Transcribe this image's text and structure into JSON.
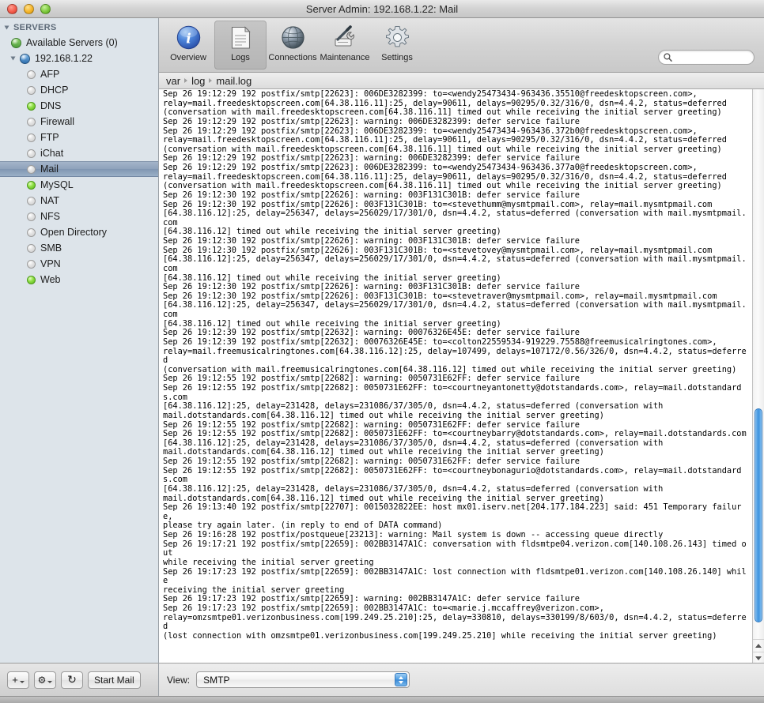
{
  "window": {
    "title": "Server Admin: 192.168.1.22: Mail"
  },
  "sidebar": {
    "group_label": "SERVERS",
    "available_servers": "Available Servers (0)",
    "host": "192.168.1.22",
    "services": [
      {
        "label": "AFP",
        "running": false
      },
      {
        "label": "DHCP",
        "running": false
      },
      {
        "label": "DNS",
        "running": true
      },
      {
        "label": "Firewall",
        "running": false
      },
      {
        "label": "FTP",
        "running": false
      },
      {
        "label": "iChat",
        "running": false
      },
      {
        "label": "Mail",
        "running": false,
        "selected": true
      },
      {
        "label": "MySQL",
        "running": true
      },
      {
        "label": "NAT",
        "running": false
      },
      {
        "label": "NFS",
        "running": false
      },
      {
        "label": "Open Directory",
        "running": false
      },
      {
        "label": "SMB",
        "running": false
      },
      {
        "label": "VPN",
        "running": false
      },
      {
        "label": "Web",
        "running": true
      }
    ],
    "buttons": {
      "add_label": "+",
      "action_label": "⚙",
      "refresh_label": "↻",
      "start_service_label": "Start Mail"
    }
  },
  "toolbar": {
    "items": [
      {
        "label": "Overview",
        "icon": "info-icon",
        "active": false
      },
      {
        "label": "Logs",
        "icon": "document-icon",
        "active": true
      },
      {
        "label": "Connections",
        "icon": "globe-icon",
        "active": false
      },
      {
        "label": "Maintenance",
        "icon": "tools-icon",
        "active": false
      },
      {
        "label": "Settings",
        "icon": "gear-icon",
        "active": false
      }
    ],
    "search": {
      "value": "",
      "placeholder": ""
    }
  },
  "breadcrumb": {
    "parts": [
      "var",
      "log",
      "mail.log"
    ]
  },
  "log": {
    "content": "Sep 26 19:12:29 192 postfix/smtp[22623]: 006DE3282399: to=<wendy25473434-963436.35510@freedesktopscreen.com>,\nrelay=mail.freedesktopscreen.com[64.38.116.11]:25, delay=90611, delays=90295/0.32/316/0, dsn=4.4.2, status=deferred\n(conversation with mail.freedesktopscreen.com[64.38.116.11] timed out while receiving the initial server greeting)\nSep 26 19:12:29 192 postfix/smtp[22623]: warning: 006DE3282399: defer service failure\nSep 26 19:12:29 192 postfix/smtp[22623]: 006DE3282399: to=<wendy25473434-963436.372b0@freedesktopscreen.com>,\nrelay=mail.freedesktopscreen.com[64.38.116.11]:25, delay=90611, delays=90295/0.32/316/0, dsn=4.4.2, status=deferred\n(conversation with mail.freedesktopscreen.com[64.38.116.11] timed out while receiving the initial server greeting)\nSep 26 19:12:29 192 postfix/smtp[22623]: warning: 006DE3282399: defer service failure\nSep 26 19:12:29 192 postfix/smtp[22623]: 006DE3282399: to=<wendy25473434-963436.377a0@freedesktopscreen.com>,\nrelay=mail.freedesktopscreen.com[64.38.116.11]:25, delay=90611, delays=90295/0.32/316/0, dsn=4.4.2, status=deferred\n(conversation with mail.freedesktopscreen.com[64.38.116.11] timed out while receiving the initial server greeting)\nSep 26 19:12:30 192 postfix/smtp[22626]: warning: 003F131C301B: defer service failure\nSep 26 19:12:30 192 postfix/smtp[22626]: 003F131C301B: to=<stevethumm@mysmtpmail.com>, relay=mail.mysmtpmail.com\n[64.38.116.12]:25, delay=256347, delays=256029/17/301/0, dsn=4.4.2, status=deferred (conversation with mail.mysmtpmail.com\n[64.38.116.12] timed out while receiving the initial server greeting)\nSep 26 19:12:30 192 postfix/smtp[22626]: warning: 003F131C301B: defer service failure\nSep 26 19:12:30 192 postfix/smtp[22626]: 003F131C301B: to=<stevetovey@mysmtpmail.com>, relay=mail.mysmtpmail.com\n[64.38.116.12]:25, delay=256347, delays=256029/17/301/0, dsn=4.4.2, status=deferred (conversation with mail.mysmtpmail.com\n[64.38.116.12] timed out while receiving the initial server greeting)\nSep 26 19:12:30 192 postfix/smtp[22626]: warning: 003F131C301B: defer service failure\nSep 26 19:12:30 192 postfix/smtp[22626]: 003F131C301B: to=<stevetraver@mysmtpmail.com>, relay=mail.mysmtpmail.com\n[64.38.116.12]:25, delay=256347, delays=256029/17/301/0, dsn=4.4.2, status=deferred (conversation with mail.mysmtpmail.com\n[64.38.116.12] timed out while receiving the initial server greeting)\nSep 26 19:12:39 192 postfix/smtp[22632]: warning: 00076326E45E: defer service failure\nSep 26 19:12:39 192 postfix/smtp[22632]: 00076326E45E: to=<colton22559534-919229.75588@freemusicalringtones.com>,\nrelay=mail.freemusicalringtones.com[64.38.116.12]:25, delay=107499, delays=107172/0.56/326/0, dsn=4.4.2, status=deferred\n(conversation with mail.freemusicalringtones.com[64.38.116.12] timed out while receiving the initial server greeting)\nSep 26 19:12:55 192 postfix/smtp[22682]: warning: 0050731E62FF: defer service failure\nSep 26 19:12:55 192 postfix/smtp[22682]: 0050731E62FF: to=<courtneyantonetty@dotstandards.com>, relay=mail.dotstandards.com\n[64.38.116.12]:25, delay=231428, delays=231086/37/305/0, dsn=4.4.2, status=deferred (conversation with\nmail.dotstandards.com[64.38.116.12] timed out while receiving the initial server greeting)\nSep 26 19:12:55 192 postfix/smtp[22682]: warning: 0050731E62FF: defer service failure\nSep 26 19:12:55 192 postfix/smtp[22682]: 0050731E62FF: to=<courtneybarry@dotstandards.com>, relay=mail.dotstandards.com\n[64.38.116.12]:25, delay=231428, delays=231086/37/305/0, dsn=4.4.2, status=deferred (conversation with\nmail.dotstandards.com[64.38.116.12] timed out while receiving the initial server greeting)\nSep 26 19:12:55 192 postfix/smtp[22682]: warning: 0050731E62FF: defer service failure\nSep 26 19:12:55 192 postfix/smtp[22682]: 0050731E62FF: to=<courtneybonagurio@dotstandards.com>, relay=mail.dotstandards.com\n[64.38.116.12]:25, delay=231428, delays=231086/37/305/0, dsn=4.4.2, status=deferred (conversation with\nmail.dotstandards.com[64.38.116.12] timed out while receiving the initial server greeting)\nSep 26 19:13:40 192 postfix/smtp[22707]: 0015032822EE: host mx01.iserv.net[204.177.184.223] said: 451 Temporary failure,\nplease try again later. (in reply to end of DATA command)\nSep 26 19:16:28 192 postfix/postqueue[23213]: warning: Mail system is down -- accessing queue directly\nSep 26 19:17:21 192 postfix/smtp[22659]: 002BB3147A1C: conversation with fldsmtpe04.verizon.com[140.108.26.143] timed out\nwhile receiving the initial server greeting\nSep 26 19:17:23 192 postfix/smtp[22659]: 002BB3147A1C: lost connection with fldsmtpe01.verizon.com[140.108.26.140] while\nreceiving the initial server greeting\nSep 26 19:17:23 192 postfix/smtp[22659]: warning: 002BB3147A1C: defer service failure\nSep 26 19:17:23 192 postfix/smtp[22659]: 002BB3147A1C: to=<marie.j.mccaffrey@verizon.com>,\nrelay=omzsmtpe01.verizonbusiness.com[199.249.25.210]:25, delay=330810, delays=330199/8/603/0, dsn=4.4.2, status=deferred\n(lost connection with omzsmtpe01.verizonbusiness.com[199.249.25.210] while receiving the initial server greeting)"
  },
  "viewbar": {
    "label": "View:",
    "selected": "SMTP"
  },
  "colors": {
    "accent": "#3f93df",
    "selection": "#8fa2bb",
    "running": "#8ede44",
    "sidebar_bg": "#dde4ea"
  }
}
